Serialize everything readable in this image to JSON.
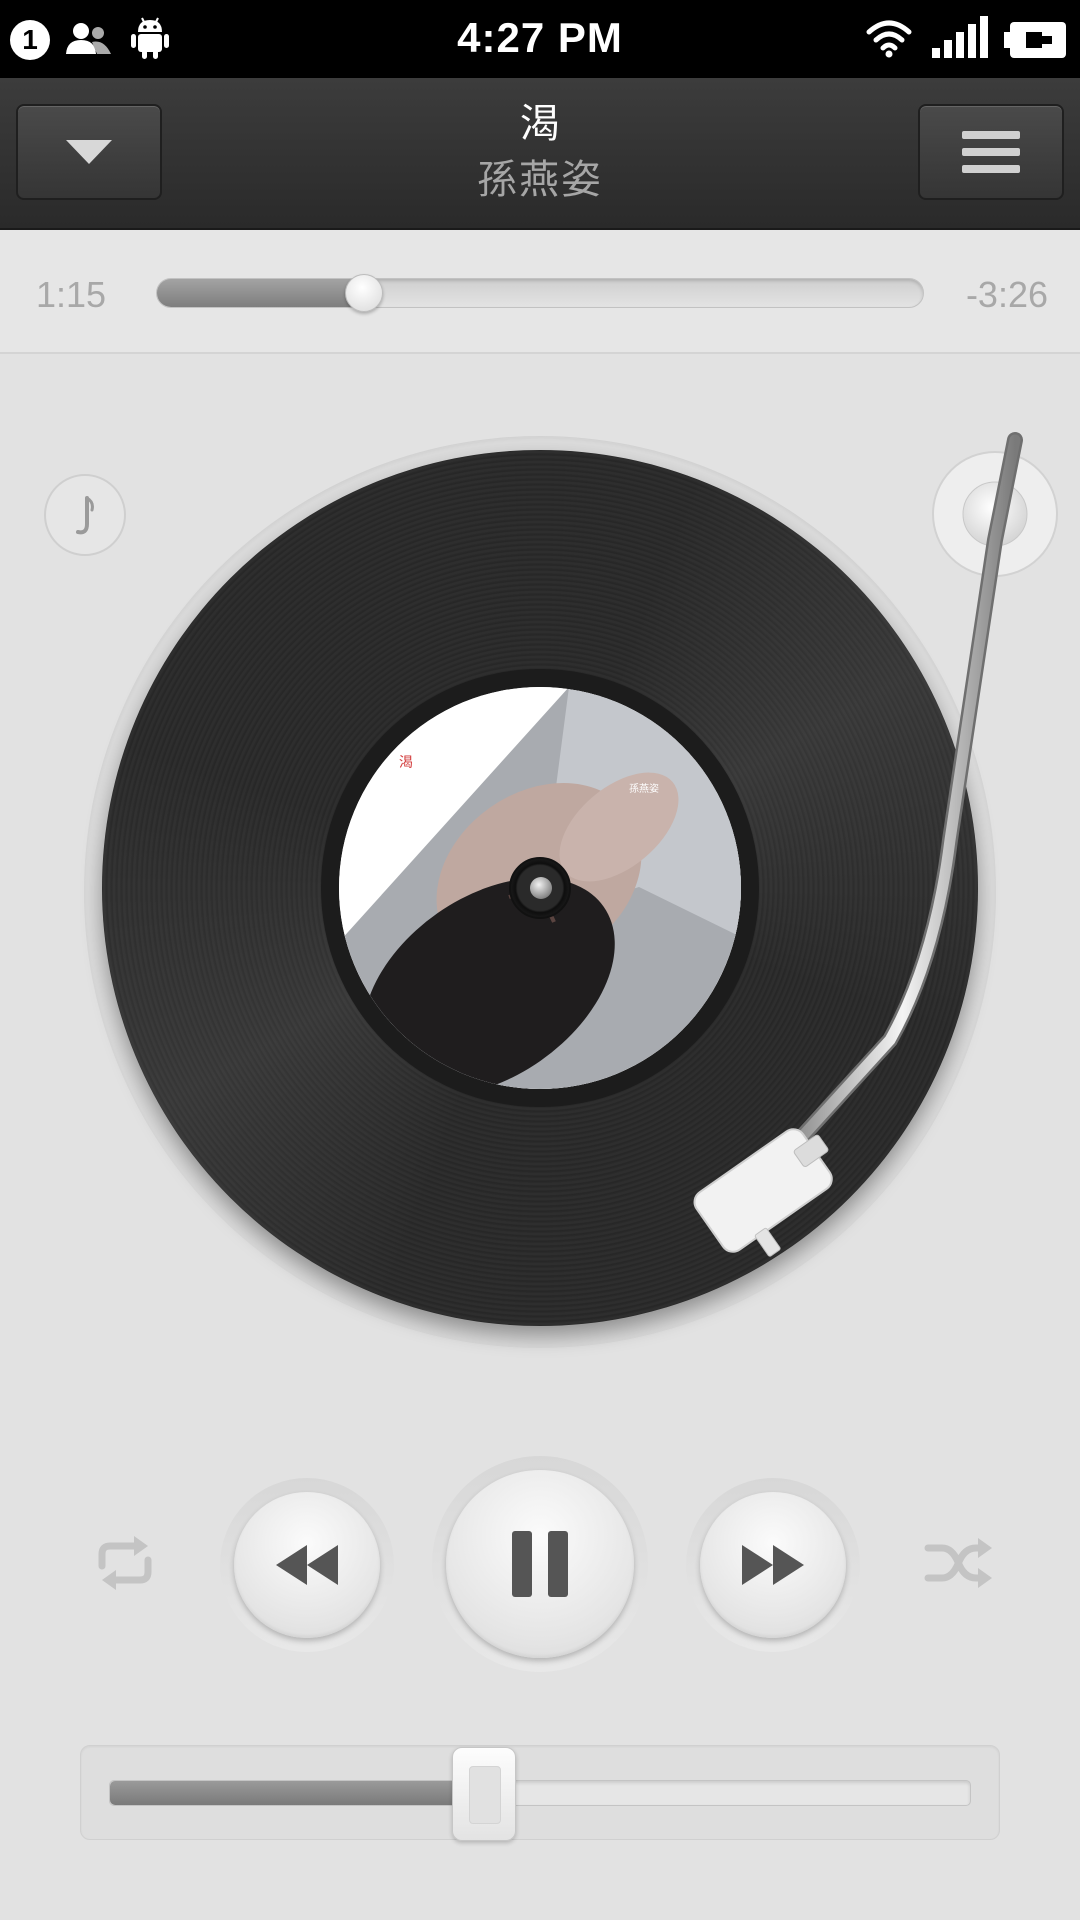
{
  "status_bar": {
    "notification_count": "1",
    "time": "4:27 PM",
    "icons": [
      "people-icon",
      "android-icon",
      "wifi-icon",
      "signal-icon",
      "battery-icon"
    ]
  },
  "header": {
    "title": "渴",
    "artist": "孫燕姿",
    "collapse_icon": "chevron-down-icon",
    "menu_icon": "menu-icon"
  },
  "playback": {
    "elapsed": "1:15",
    "remaining": "-3:26",
    "progress_fraction": 0.27
  },
  "controls": {
    "repeat_icon": "repeat-icon",
    "previous_icon": "rewind-icon",
    "play_pause_icon": "pause-icon",
    "next_icon": "fast-forward-icon",
    "shuffle_icon": "shuffle-icon",
    "lyrics_icon": "lyrics-icon"
  },
  "volume": {
    "level_fraction": 0.435
  },
  "colors": {
    "header_bg": "#2f2f2f",
    "body_bg": "#e2e2e2",
    "record": "#2b2b2b",
    "icon_grey": "#555555"
  }
}
